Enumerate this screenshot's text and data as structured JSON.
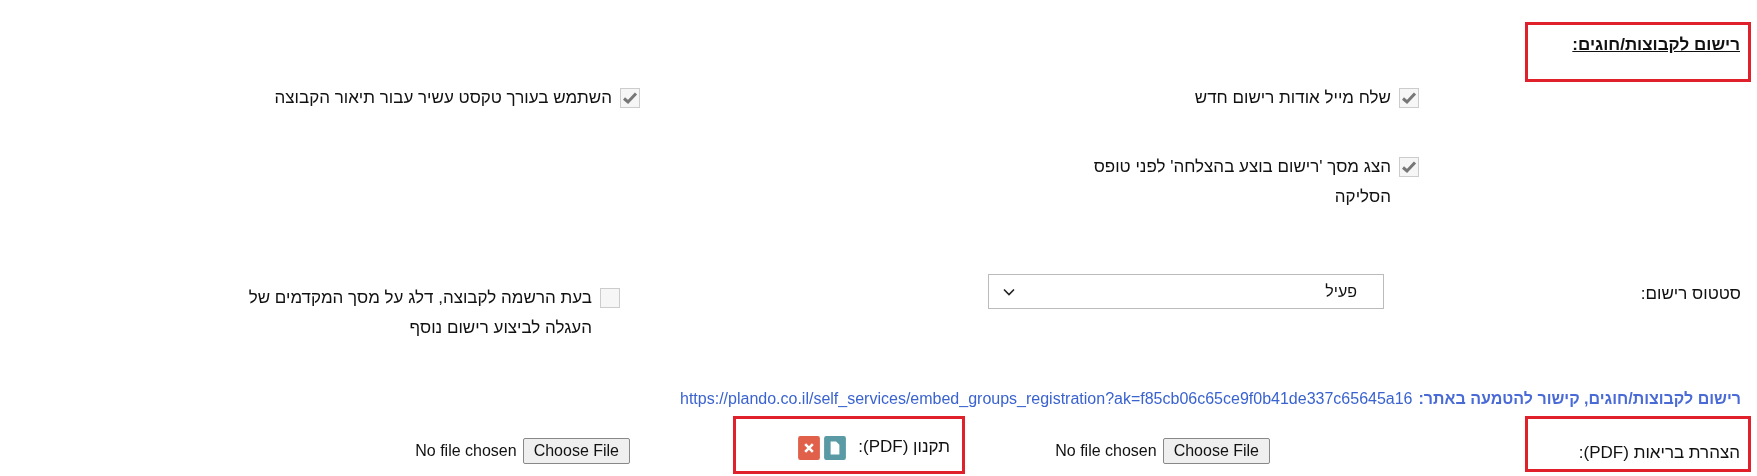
{
  "section": {
    "title": "רישום לקבוצות/חוגים:",
    "highlighted": true
  },
  "options": [
    {
      "label": "שלח מייל אודות רישום חדש",
      "checked": true
    },
    {
      "label": "השתמש בעורך טקסט עשיר עבור תיאור הקבוצה",
      "checked": true
    },
    {
      "label": "הצג מסך 'רישום בוצע בהצלחה' לפני טופס הסליקה",
      "checked": true
    },
    {
      "label": "בעת הרשמה לקבוצה, דלג על מסך המקדמים של העגלה לביצוע רישום נוסף",
      "checked": false
    }
  ],
  "registration_status": {
    "label": "סטטוס רישום:",
    "value": "פעיל"
  },
  "embed_link": {
    "label": "רישום לקבוצות/חוגים, קישור להטמעה באתר:",
    "url": "https://plando.co.il/self_services/embed_groups_registration?ak=f85cb06c65ce9f0b41de337c65645a16"
  },
  "uploads": [
    {
      "label": "הצהרת בריאות (PDF):",
      "highlighted": true,
      "button": "Choose File",
      "status": "No file chosen"
    },
    {
      "label": "תקנון (PDF):",
      "highlighted": true,
      "file_attached": true,
      "button": "Choose File",
      "status": "No file chosen"
    }
  ]
}
